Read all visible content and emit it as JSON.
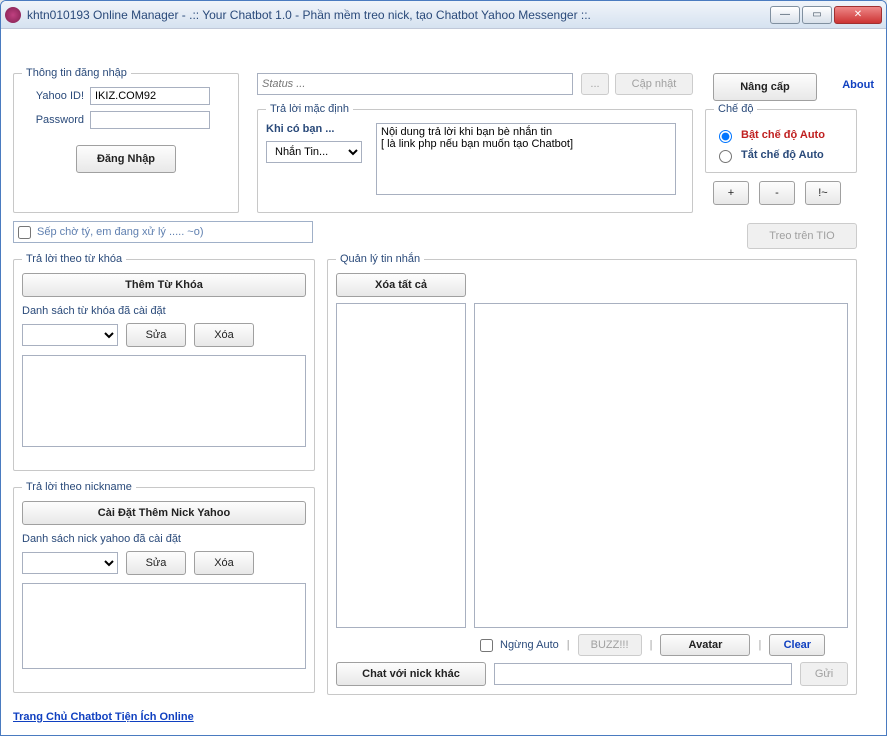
{
  "window": {
    "title": "khtn010193 Online Manager - .:: Your Chatbot 1.0 - Phần mềm treo nick, tạo Chatbot Yahoo Messenger ::."
  },
  "login": {
    "legend": "Thông tin đăng nhập",
    "yahoo_id_label": "Yahoo ID!",
    "yahoo_id_value": "IKIZ.COM92",
    "password_label": "Password",
    "password_value": "",
    "login_button": "Đăng Nhập"
  },
  "status": {
    "placeholder": "Status ...",
    "dots": "...",
    "update": "Cập nhật",
    "upgrade": "Nâng cấp",
    "about": "About"
  },
  "default_reply": {
    "legend": "Trả lời mặc định",
    "when_label": "Khi có bạn ...",
    "dropdown_selected": "Nhắn Tin...",
    "content": "Nội dung trả lời khi bạn bè nhắn tin\n[ là link php nếu bạn muốn tạo Chatbot]"
  },
  "mode": {
    "legend": "Chế độ",
    "auto_on": "Bật chế độ Auto",
    "auto_off": "Tắt chế độ Auto"
  },
  "plusminus": {
    "plus": "+",
    "minus": "-",
    "excl": "!~"
  },
  "tio_button": "Treo trên TIO",
  "wait_text": "Sếp chờ tý, em đang xử lý ..... ~o)",
  "keyword": {
    "legend": "Trả lời theo từ khóa",
    "add_button": "Thêm Từ Khóa",
    "list_label": "Danh sách từ khóa đã cài đặt",
    "edit": "Sửa",
    "delete": "Xóa"
  },
  "nickname": {
    "legend": "Trả lời theo nickname",
    "add_button": "Cài Đặt Thêm Nick Yahoo",
    "list_label": "Danh sách nick yahoo đã cài đặt",
    "edit": "Sửa",
    "delete": "Xóa"
  },
  "msg": {
    "legend": "Quản lý tin nhắn",
    "clear_all": "Xóa tất cả",
    "stop_auto": "Ngừng Auto",
    "buzz": "BUZZ!!!",
    "avatar": "Avatar",
    "clear": "Clear",
    "chat_other": "Chat với nick khác",
    "send": "Gửi"
  },
  "footer": {
    "link": "Trang Chủ Chatbot Tiện Ích Online"
  }
}
